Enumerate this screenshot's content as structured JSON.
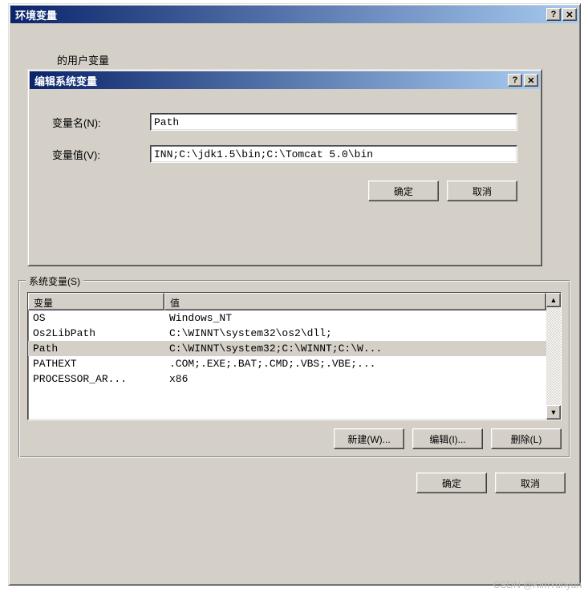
{
  "parentWindow": {
    "title": "环境变量",
    "helpBtn": "?",
    "closeBtn": "✕",
    "userVarsPartial": "的用户变量",
    "systemVars": {
      "groupTitle": "系统变量(S)",
      "headerVar": "变量",
      "headerVal": "值",
      "rows": [
        {
          "name": "OS",
          "value": "Windows_NT",
          "selected": false
        },
        {
          "name": "Os2LibPath",
          "value": "C:\\WINNT\\system32\\os2\\dll;",
          "selected": false
        },
        {
          "name": "Path",
          "value": "C:\\WINNT\\system32;C:\\WINNT;C:\\W...",
          "selected": true
        },
        {
          "name": "PATHEXT",
          "value": ".COM;.EXE;.BAT;.CMD;.VBS;.VBE;...",
          "selected": false
        },
        {
          "name": "PROCESSOR_AR...",
          "value": "x86",
          "selected": false
        }
      ],
      "newBtn": "新建(W)...",
      "editBtn": "编辑(I)...",
      "deleteBtn": "删除(L)"
    },
    "okBtn": "确定",
    "cancelBtn": "取消"
  },
  "editDialog": {
    "title": "编辑系统变量",
    "helpBtn": "?",
    "closeBtn": "✕",
    "nameLabel": "变量名(N):",
    "nameValue": "Path",
    "valueLabel": "变量值(V):",
    "valueValue": "INN;C:\\jdk1.5\\bin;C:\\Tomcat 5.0\\bin",
    "okBtn": "确定",
    "cancelBtn": "取消"
  },
  "watermark": "CSDN @KimYuhyun"
}
